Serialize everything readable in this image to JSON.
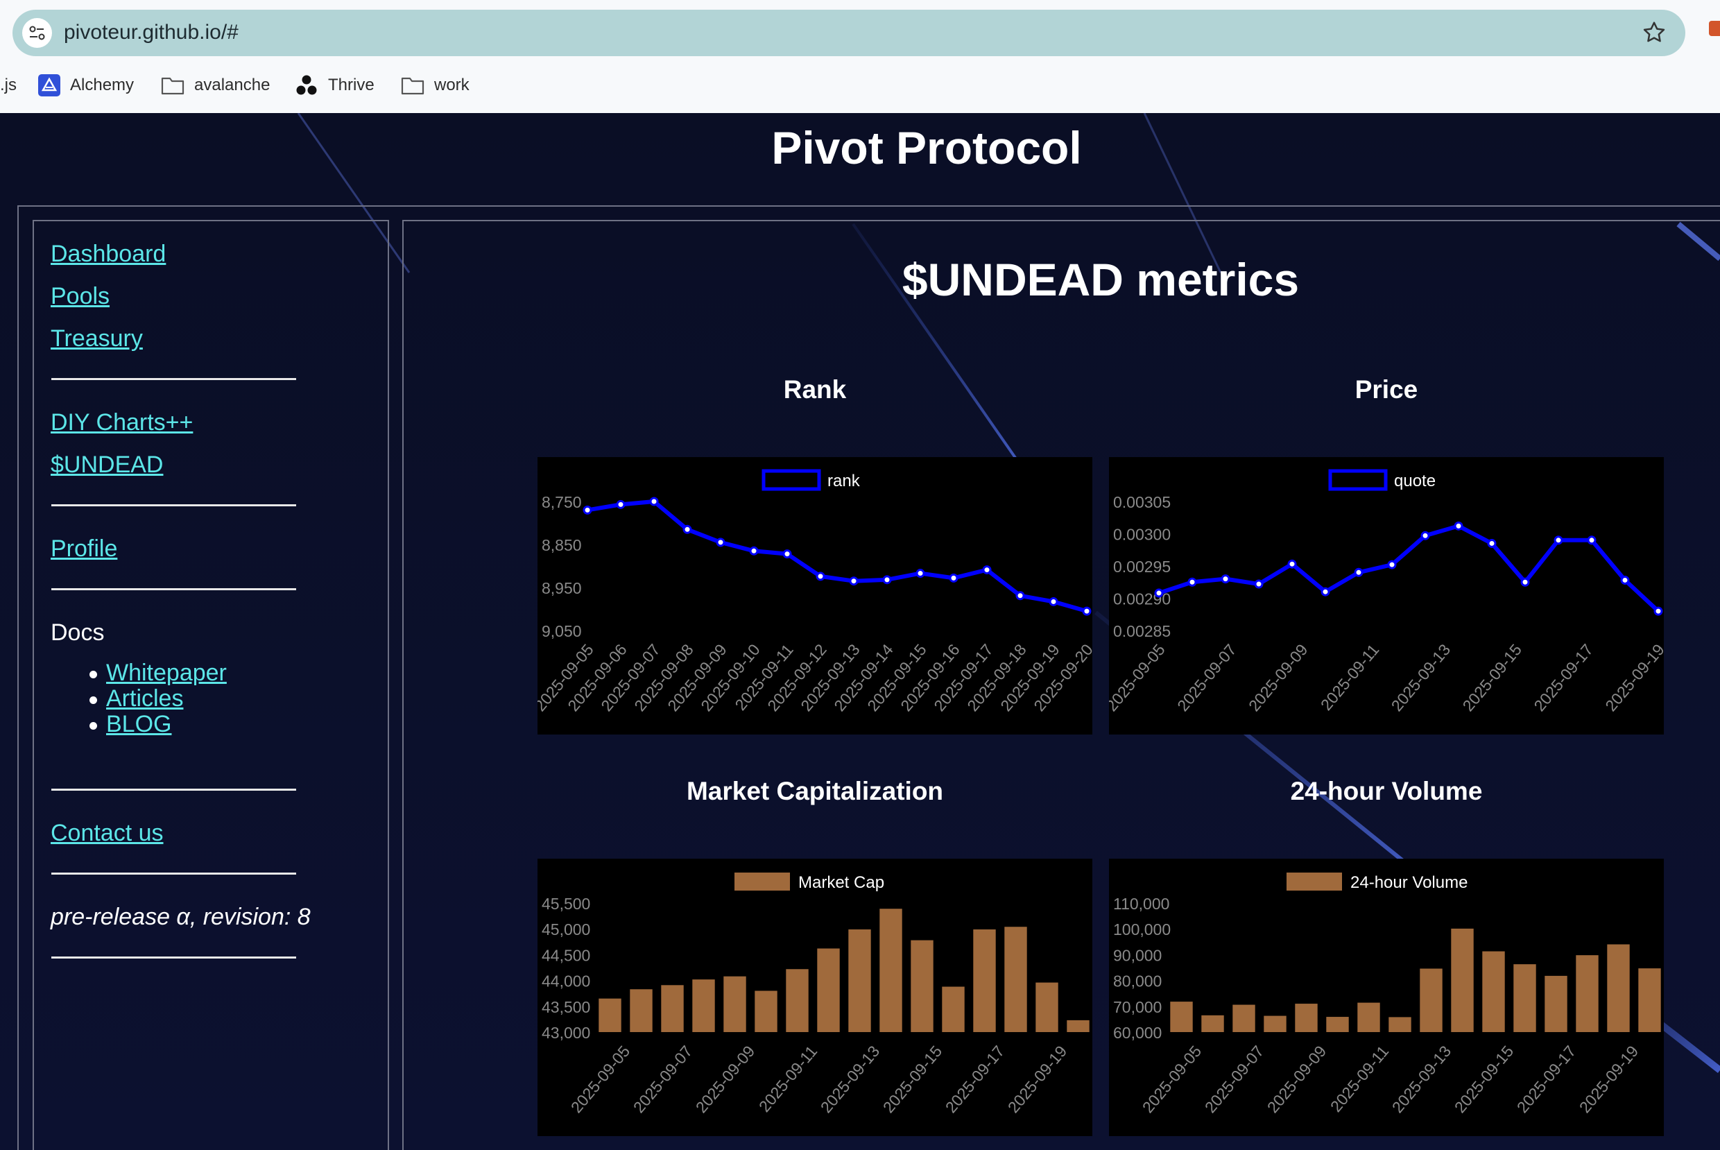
{
  "browser": {
    "url": "pivoteur.github.io/#",
    "bookmarks": [
      {
        "label": ".js",
        "icon": "none"
      },
      {
        "label": "Alchemy",
        "icon": "alchemy-icon"
      },
      {
        "label": "avalanche",
        "icon": "folder-icon"
      },
      {
        "label": "Thrive",
        "icon": "thrive-icon"
      },
      {
        "label": "work",
        "icon": "folder-icon"
      }
    ]
  },
  "site": {
    "title": "Pivot Protocol"
  },
  "sidebar": {
    "links_top": [
      "Dashboard",
      "Pools",
      "Treasury"
    ],
    "links_mid": [
      "DIY Charts++",
      "$UNDEAD"
    ],
    "profile": "Profile",
    "docs_heading": "Docs",
    "docs_links": [
      "Whitepaper",
      "Articles",
      "BLOG"
    ],
    "contact": "Contact us",
    "release": "pre-release α, revision: 8"
  },
  "main": {
    "title": "$UNDEAD metrics"
  },
  "colors": {
    "link": "#5ce6e8",
    "line_series": "#0000ff",
    "bar_series": "#a06a3c",
    "background": "#0b0e26"
  },
  "chart_data": [
    {
      "type": "line",
      "title": "Rank",
      "x": [
        "2025-09-05",
        "2025-09-06",
        "2025-09-07",
        "2025-09-08",
        "2025-09-09",
        "2025-09-10",
        "2025-09-11",
        "2025-09-12",
        "2025-09-13",
        "2025-09-14",
        "2025-09-15",
        "2025-09-16",
        "2025-09-17",
        "2025-09-18",
        "2025-09-19",
        "2025-09-20"
      ],
      "series": [
        {
          "name": "rank",
          "values": [
            8770,
            8757,
            8750,
            8815,
            8845,
            8865,
            8872,
            8924,
            8935,
            8932,
            8917,
            8928,
            8909,
            8969,
            8983,
            9005
          ]
        }
      ],
      "y_ticks": [
        "8,750",
        "8,850",
        "8,950",
        "9,050"
      ],
      "ylim": [
        8750,
        9050
      ],
      "y_reversed": true,
      "legend": "top-center"
    },
    {
      "type": "line",
      "title": "Price",
      "x": [
        "2025-09-05",
        "2025-09-06",
        "2025-09-07",
        "2025-09-08",
        "2025-09-09",
        "2025-09-10",
        "2025-09-11",
        "2025-09-12",
        "2025-09-13",
        "2025-09-14",
        "2025-09-15",
        "2025-09-16",
        "2025-09-17",
        "2025-09-18",
        "2025-09-19"
      ],
      "x_tick_labels": [
        "2025-09-05",
        "2025-09-07",
        "2025-09-09",
        "2025-09-11",
        "2025-09-13",
        "2025-09-15",
        "2025-09-17",
        "2025-09-19"
      ],
      "series": [
        {
          "name": "quote",
          "values": [
            0.002908,
            0.002925,
            0.00293,
            0.002922,
            0.002953,
            0.00291,
            0.00294,
            0.002952,
            0.002997,
            0.003012,
            0.002985,
            0.002925,
            0.00299,
            0.00299,
            0.002928,
            0.00288
          ]
        }
      ],
      "y_ticks": [
        "0.00305",
        "0.00300",
        "0.00295",
        "0.00290",
        "0.00285"
      ],
      "ylim": [
        0.00285,
        0.00305
      ],
      "legend": "top-center"
    },
    {
      "type": "bar",
      "title": "Market Capitalization",
      "categories": [
        "2025-09-05",
        "2025-09-06",
        "2025-09-07",
        "2025-09-08",
        "2025-09-09",
        "2025-09-10",
        "2025-09-11",
        "2025-09-12",
        "2025-09-13",
        "2025-09-14",
        "2025-09-15",
        "2025-09-16",
        "2025-09-17",
        "2025-09-18",
        "2025-09-19",
        "2025-09-20"
      ],
      "x_tick_labels": [
        "2025-09-05",
        "2025-09-07",
        "2025-09-09",
        "2025-09-11",
        "2025-09-13",
        "2025-09-15",
        "2025-09-17",
        "2025-09-19"
      ],
      "series": [
        {
          "name": "Market Cap",
          "values": [
            43650,
            43830,
            43910,
            44020,
            44080,
            43800,
            44220,
            44620,
            44990,
            45390,
            44780,
            43880,
            44990,
            45040,
            43960,
            43230
          ]
        }
      ],
      "y_ticks": [
        "45,500",
        "45,000",
        "44,500",
        "44,000",
        "43,500",
        "43,000"
      ],
      "ylim": [
        43000,
        45500
      ],
      "legend": "top-center"
    },
    {
      "type": "bar",
      "title": "24-hour Volume",
      "categories": [
        "2025-09-05",
        "2025-09-06",
        "2025-09-07",
        "2025-09-08",
        "2025-09-09",
        "2025-09-10",
        "2025-09-11",
        "2025-09-12",
        "2025-09-13",
        "2025-09-14",
        "2025-09-15",
        "2025-09-16",
        "2025-09-17",
        "2025-09-18",
        "2025-09-19",
        "2025-09-20"
      ],
      "x_tick_labels": [
        "2025-09-05",
        "2025-09-07",
        "2025-09-09",
        "2025-09-11",
        "2025-09-13",
        "2025-09-15",
        "2025-09-17",
        "2025-09-19"
      ],
      "series": [
        {
          "name": "24-hour Volume",
          "values": [
            71800,
            66500,
            70600,
            66300,
            71000,
            65900,
            71400,
            65800,
            84600,
            100100,
            91300,
            86300,
            81800,
            89800,
            94000,
            84700
          ]
        }
      ],
      "y_ticks": [
        "110,000",
        "100,000",
        "90,000",
        "80,000",
        "70,000",
        "60,000"
      ],
      "ylim": [
        60000,
        110000
      ],
      "legend": "top-center"
    }
  ]
}
